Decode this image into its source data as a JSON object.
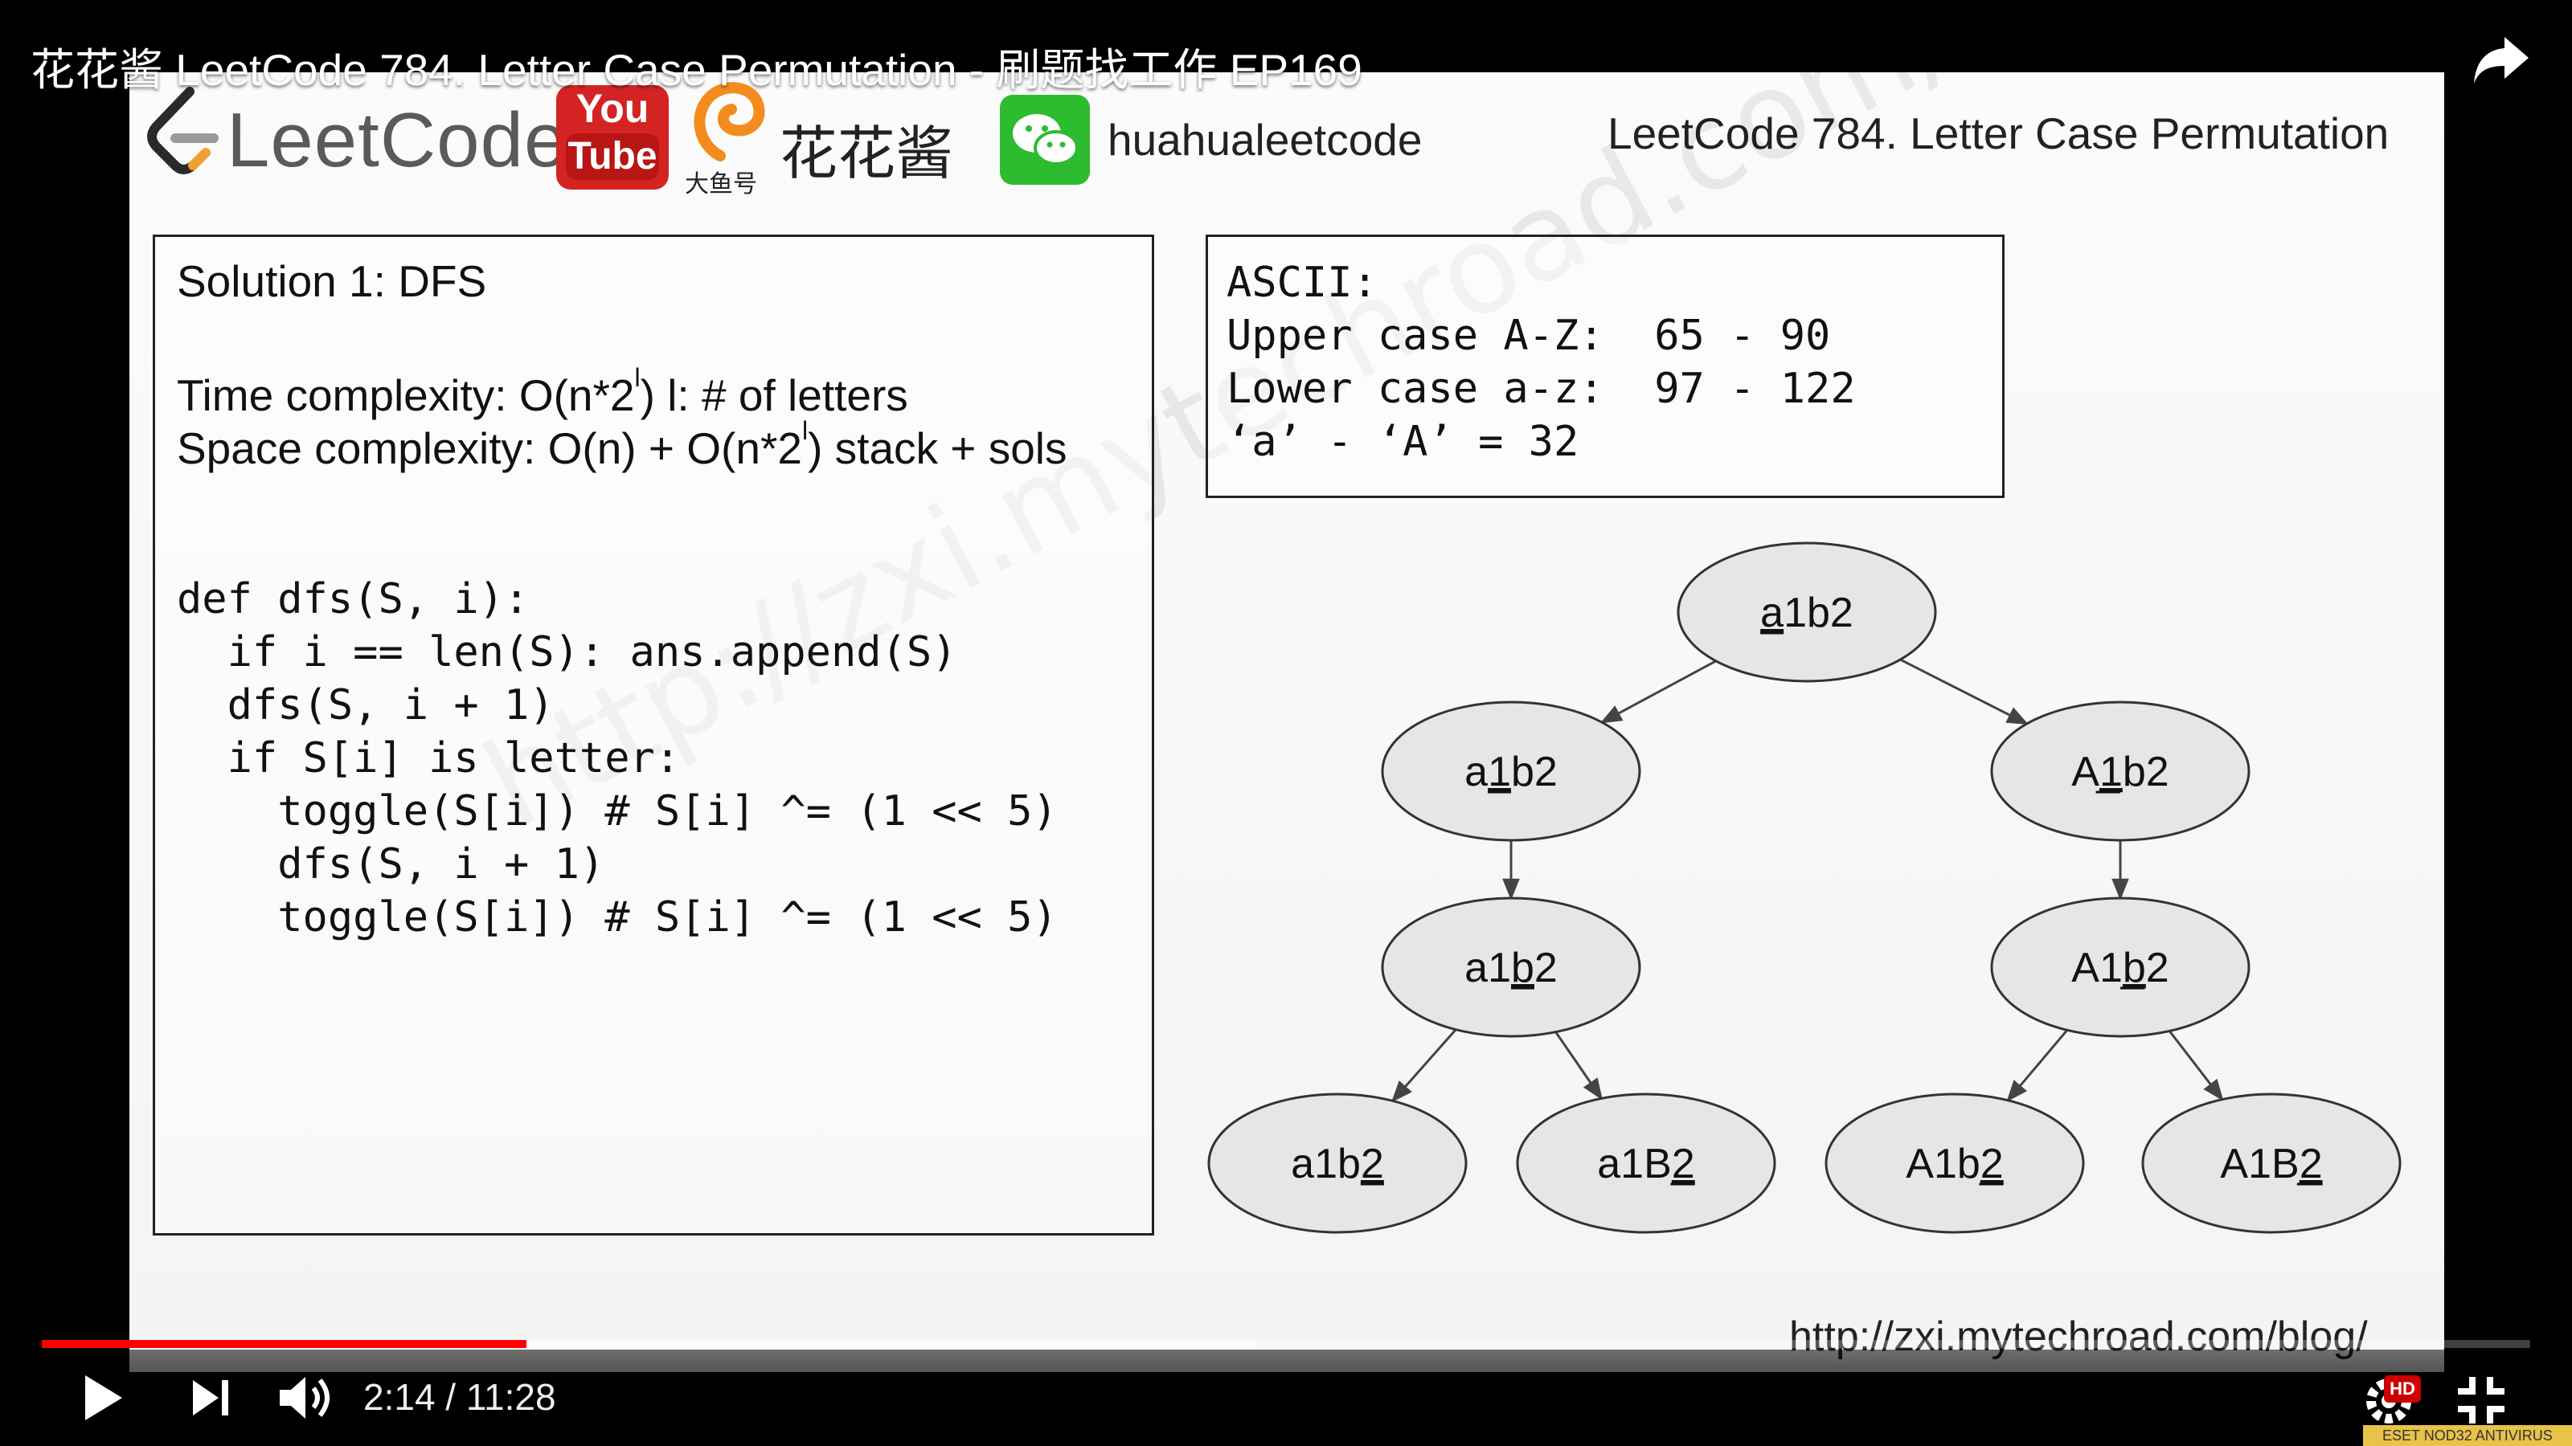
{
  "video": {
    "title": "花花酱 LeetCode 784. Letter Case Permutation - 刷题找工作 EP169"
  },
  "header": {
    "leetcode_word": "LeetCode",
    "youtube_top": "You",
    "youtube_bottom": "Tube",
    "dayuhao": "大鱼号",
    "huahuajiang": "花花酱",
    "wechat_id": "huahualeetcode",
    "slide_title": "LeetCode 784. Letter Case Permutation"
  },
  "solution": {
    "heading": "Solution 1: DFS",
    "time_prefix": "Time complexity: O(n*2",
    "time_sup": "l",
    "time_suffix": ") l: # of letters",
    "space_prefix": "Space complexity: O(n) + O(n*2",
    "space_sup": "l",
    "space_suffix": ") stack + sols",
    "code": [
      "def dfs(S, i):",
      "  if i == len(S): ans.append(S)",
      "  dfs(S, i + 1)",
      "  if S[i] is letter:",
      "    toggle(S[i]) # S[i] ^= (1 << 5)",
      "    dfs(S, i + 1)",
      "    toggle(S[i]) # S[i] ^= (1 << 5)"
    ]
  },
  "ascii": {
    "lines": [
      "ASCII:",
      "Upper case A-Z:  65 - 90",
      "Lower case a-z:  97 - 122",
      "‘a’ - ‘A’ = 32"
    ]
  },
  "tree": {
    "nodes": [
      {
        "id": "root",
        "pre": "",
        "u": "a",
        "post": "1b2"
      },
      {
        "id": "l1",
        "pre": "a",
        "u": "1",
        "post": "b2"
      },
      {
        "id": "r1",
        "pre": "A",
        "u": "1",
        "post": "b2"
      },
      {
        "id": "l2",
        "pre": "a1",
        "u": "b",
        "post": "2"
      },
      {
        "id": "r2",
        "pre": "A1",
        "u": "b",
        "post": "2"
      },
      {
        "id": "ll",
        "pre": "a1b",
        "u": "2",
        "post": ""
      },
      {
        "id": "lr",
        "pre": "a1B",
        "u": "2",
        "post": ""
      },
      {
        "id": "rl",
        "pre": "A1b",
        "u": "2",
        "post": ""
      },
      {
        "id": "rr",
        "pre": "A1B",
        "u": "2",
        "post": ""
      }
    ],
    "edges": [
      [
        "root",
        "l1"
      ],
      [
        "root",
        "r1"
      ],
      [
        "l1",
        "l2"
      ],
      [
        "r1",
        "r2"
      ],
      [
        "l2",
        "ll"
      ],
      [
        "l2",
        "lr"
      ],
      [
        "r2",
        "rl"
      ],
      [
        "r2",
        "rr"
      ]
    ]
  },
  "watermark": "http://zxi.mytechroad.com/blog/ 花花酱 LeetCode",
  "footer_url": "http://zxi.mytechroad.com/blog/",
  "player": {
    "current_time": "2:14",
    "duration": "11:28",
    "time_display": "2:14 / 11:28",
    "progress": 0.1948,
    "buffered": 0.488,
    "hd_badge": "HD",
    "antivirus_text": "ESET NOD32 ANTIVIRUS",
    "colors": {
      "played": "#ff0000",
      "slide_bg": "#f7f7f7"
    }
  }
}
